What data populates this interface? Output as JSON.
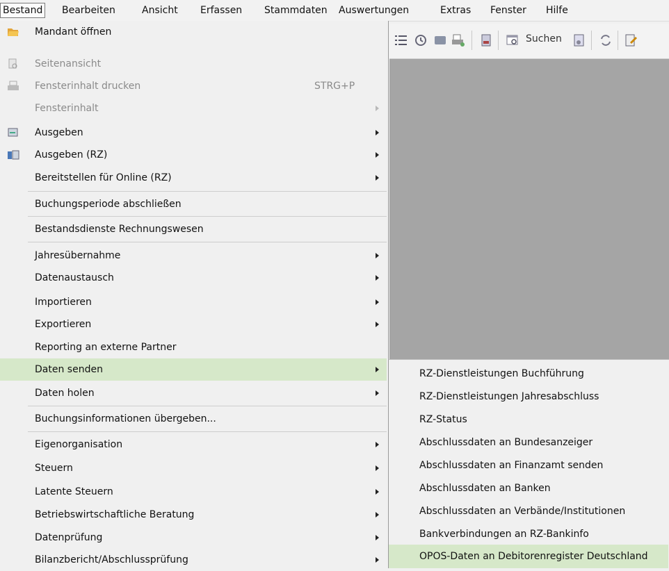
{
  "menubar": {
    "items": [
      "Bestand",
      "Bearbeiten",
      "Ansicht",
      "Erfassen",
      "Stammdaten",
      "Auswertungen",
      "Extras",
      "Fenster",
      "Hilfe"
    ]
  },
  "toolbar": {
    "search_label": "Suchen"
  },
  "menu": {
    "items": [
      {
        "label": "Mandant öffnen",
        "icon": "folder-open-icon"
      },
      {
        "label": "Seitenansicht",
        "icon": "print-preview-icon",
        "disabled": true
      },
      {
        "label": "Fensterinhalt drucken",
        "shortcut": "STRG+P",
        "icon": "printer-icon",
        "disabled": true
      },
      {
        "label": "Fensterinhalt",
        "disabled": true,
        "submenu": true
      },
      {
        "label": "Ausgeben",
        "icon": "output-icon",
        "submenu": true
      },
      {
        "label": "Ausgeben (RZ)",
        "icon": "output-rz-icon",
        "submenu": true
      },
      {
        "label": "Bereitstellen für Online (RZ)",
        "submenu": true
      },
      {
        "label": "Buchungsperiode abschließen"
      },
      {
        "label": "Bestandsdienste Rechnungswesen"
      },
      {
        "label": "Jahresübernahme",
        "submenu": true
      },
      {
        "label": "Datenaustausch",
        "submenu": true
      },
      {
        "label": "Importieren",
        "submenu": true
      },
      {
        "label": "Exportieren",
        "submenu": true
      },
      {
        "label": "Reporting an externe Partner"
      },
      {
        "label": "Daten senden",
        "submenu": true,
        "highlighted": true
      },
      {
        "label": "Daten holen",
        "submenu": true
      },
      {
        "label": "Buchungsinformationen übergeben..."
      },
      {
        "label": "Eigenorganisation",
        "submenu": true
      },
      {
        "label": "Steuern",
        "submenu": true
      },
      {
        "label": "Latente Steuern",
        "submenu": true
      },
      {
        "label": "Betriebswirtschaftliche Beratung",
        "submenu": true
      },
      {
        "label": "Datenprüfung",
        "submenu": true
      },
      {
        "label": "Bilanzbericht/Abschlussprüfung",
        "submenu": true
      }
    ]
  },
  "submenu": {
    "items": [
      {
        "label": "RZ-Dienstleistungen Buchführung"
      },
      {
        "label": "RZ-Dienstleistungen Jahresabschluss"
      },
      {
        "label": "RZ-Status"
      },
      {
        "label": "Abschlussdaten an Bundesanzeiger"
      },
      {
        "label": "Abschlussdaten an Finanzamt senden"
      },
      {
        "label": "Abschlussdaten an Banken"
      },
      {
        "label": "Abschlussdaten an Verbände/Institutionen"
      },
      {
        "label": "Bankverbindungen an RZ-Bankinfo"
      },
      {
        "label": "OPOS-Daten an Debitorenregister Deutschland",
        "highlighted": true
      }
    ]
  },
  "colors": {
    "highlight": "#d6e8c9",
    "workspace": "#a5a5a5",
    "menu_bg": "#f0f0f0"
  }
}
